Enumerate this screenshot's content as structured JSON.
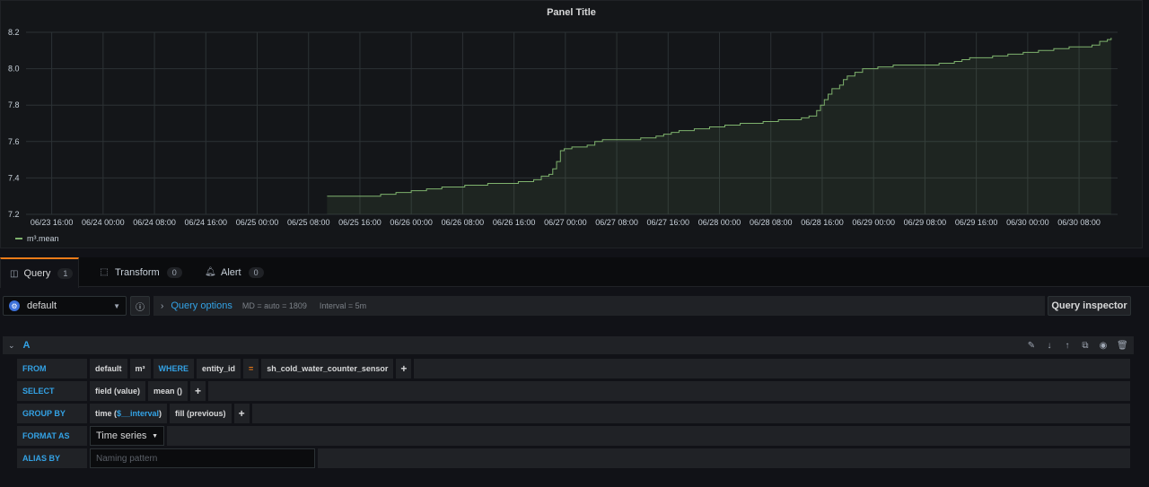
{
  "panel": {
    "title": "Panel Title",
    "legend": "m³.mean"
  },
  "chart_data": {
    "type": "area",
    "title": "Panel Title",
    "series": [
      {
        "name": "m³.mean",
        "color": "#7eb26d",
        "points": [
          [
            72,
            7.3
          ],
          [
            84,
            7.3
          ],
          [
            86,
            7.31
          ],
          [
            90,
            7.32
          ],
          [
            94,
            7.33
          ],
          [
            98,
            7.34
          ],
          [
            102,
            7.35
          ],
          [
            108,
            7.36
          ],
          [
            114,
            7.37
          ],
          [
            120,
            7.37
          ],
          [
            122,
            7.38
          ],
          [
            126,
            7.39
          ],
          [
            128,
            7.41
          ],
          [
            130,
            7.42
          ],
          [
            131,
            7.45
          ],
          [
            132,
            7.49
          ],
          [
            133,
            7.55
          ],
          [
            134,
            7.56
          ],
          [
            136,
            7.57
          ],
          [
            140,
            7.58
          ],
          [
            142,
            7.6
          ],
          [
            144,
            7.61
          ],
          [
            154,
            7.62
          ],
          [
            158,
            7.63
          ],
          [
            160,
            7.64
          ],
          [
            162,
            7.65
          ],
          [
            164,
            7.66
          ],
          [
            168,
            7.67
          ],
          [
            172,
            7.68
          ],
          [
            176,
            7.69
          ],
          [
            180,
            7.7
          ],
          [
            186,
            7.71
          ],
          [
            190,
            7.72
          ],
          [
            196,
            7.73
          ],
          [
            198,
            7.74
          ],
          [
            200,
            7.77
          ],
          [
            201,
            7.8
          ],
          [
            202,
            7.83
          ],
          [
            203,
            7.86
          ],
          [
            204,
            7.89
          ],
          [
            206,
            7.91
          ],
          [
            207,
            7.94
          ],
          [
            208,
            7.96
          ],
          [
            210,
            7.98
          ],
          [
            212,
            8.0
          ],
          [
            216,
            8.01
          ],
          [
            220,
            8.02
          ],
          [
            232,
            8.03
          ],
          [
            236,
            8.04
          ],
          [
            238,
            8.05
          ],
          [
            240,
            8.06
          ],
          [
            246,
            8.07
          ],
          [
            250,
            8.08
          ],
          [
            254,
            8.09
          ],
          [
            258,
            8.1
          ],
          [
            262,
            8.11
          ],
          [
            266,
            8.12
          ],
          [
            272,
            8.13
          ],
          [
            274,
            8.15
          ],
          [
            276,
            8.16
          ],
          [
            277,
            8.17
          ]
        ]
      }
    ],
    "x_ticks": [
      "06/23 16:00",
      "06/24 00:00",
      "06/24 08:00",
      "06/24 16:00",
      "06/25 00:00",
      "06/25 08:00",
      "06/25 16:00",
      "06/26 00:00",
      "06/26 08:00",
      "06/26 16:00",
      "06/27 00:00",
      "06/27 08:00",
      "06/27 16:00",
      "06/28 00:00",
      "06/28 08:00",
      "06/28 16:00",
      "06/29 00:00",
      "06/29 08:00",
      "06/29 16:00",
      "06/30 00:00",
      "06/30 08:00"
    ],
    "x_tick_values": [
      0,
      8,
      16,
      24,
      32,
      40,
      48,
      56,
      64,
      72,
      80,
      88,
      96,
      104,
      112,
      120,
      128,
      136,
      144,
      152,
      160
    ],
    "x_offset_hours_note": "",
    "xlim": [
      -4,
      166
    ],
    "y_ticks": [
      "7.2",
      "7.4",
      "7.6",
      "7.8",
      "8.0",
      "8.2"
    ],
    "ylim": [
      7.2,
      8.2
    ],
    "grid": true,
    "legend_position": "bottom-left"
  },
  "tabs": [
    {
      "label": "Query",
      "count": "1",
      "icon": "database-icon",
      "active": true
    },
    {
      "label": "Transform",
      "count": "0",
      "icon": "transform-icon",
      "active": false
    },
    {
      "label": "Alert",
      "count": "0",
      "icon": "bell-icon",
      "active": false
    }
  ],
  "query_bar": {
    "datasource": "default",
    "options_label": "Query options",
    "md_text": "MD = auto = 1809",
    "interval_text": "Interval = 5m",
    "inspector_label": "Query inspector"
  },
  "query": {
    "letter": "A",
    "from": {
      "label": "FROM",
      "policy": "default",
      "measurement": "m³",
      "where_kw": "WHERE",
      "tag_key": "entity_id",
      "operator": "=",
      "tag_value": "sh_cold_water_counter_sensor"
    },
    "select": {
      "label": "SELECT",
      "field": "field (value)",
      "agg": "mean ()"
    },
    "group_by": {
      "label": "GROUP BY",
      "time_prefix": "time (",
      "time_var": "$__interval",
      "time_suffix": ")",
      "fill": "fill (previous)"
    },
    "format_as": {
      "label": "FORMAT AS",
      "value": "Time series"
    },
    "alias_by": {
      "label": "ALIAS BY",
      "placeholder": "Naming pattern"
    },
    "plus": "+"
  }
}
